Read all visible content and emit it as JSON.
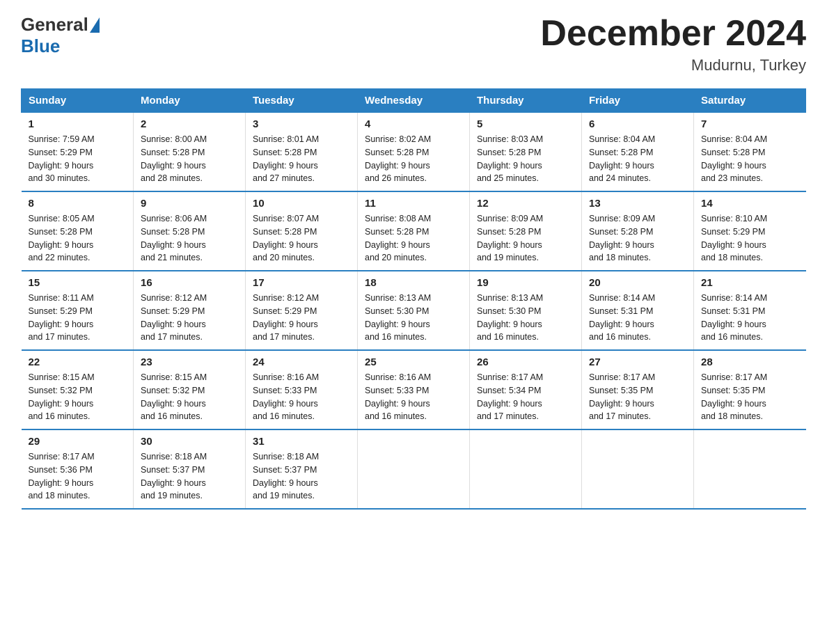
{
  "header": {
    "logo_text_general": "General",
    "logo_text_blue": "Blue",
    "month_title": "December 2024",
    "location": "Mudurnu, Turkey"
  },
  "days_of_week": [
    "Sunday",
    "Monday",
    "Tuesday",
    "Wednesday",
    "Thursday",
    "Friday",
    "Saturday"
  ],
  "weeks": [
    [
      {
        "day": 1,
        "sunrise": "7:59 AM",
        "sunset": "5:29 PM",
        "daylight": "9 hours and 30 minutes."
      },
      {
        "day": 2,
        "sunrise": "8:00 AM",
        "sunset": "5:28 PM",
        "daylight": "9 hours and 28 minutes."
      },
      {
        "day": 3,
        "sunrise": "8:01 AM",
        "sunset": "5:28 PM",
        "daylight": "9 hours and 27 minutes."
      },
      {
        "day": 4,
        "sunrise": "8:02 AM",
        "sunset": "5:28 PM",
        "daylight": "9 hours and 26 minutes."
      },
      {
        "day": 5,
        "sunrise": "8:03 AM",
        "sunset": "5:28 PM",
        "daylight": "9 hours and 25 minutes."
      },
      {
        "day": 6,
        "sunrise": "8:04 AM",
        "sunset": "5:28 PM",
        "daylight": "9 hours and 24 minutes."
      },
      {
        "day": 7,
        "sunrise": "8:04 AM",
        "sunset": "5:28 PM",
        "daylight": "9 hours and 23 minutes."
      }
    ],
    [
      {
        "day": 8,
        "sunrise": "8:05 AM",
        "sunset": "5:28 PM",
        "daylight": "9 hours and 22 minutes."
      },
      {
        "day": 9,
        "sunrise": "8:06 AM",
        "sunset": "5:28 PM",
        "daylight": "9 hours and 21 minutes."
      },
      {
        "day": 10,
        "sunrise": "8:07 AM",
        "sunset": "5:28 PM",
        "daylight": "9 hours and 20 minutes."
      },
      {
        "day": 11,
        "sunrise": "8:08 AM",
        "sunset": "5:28 PM",
        "daylight": "9 hours and 20 minutes."
      },
      {
        "day": 12,
        "sunrise": "8:09 AM",
        "sunset": "5:28 PM",
        "daylight": "9 hours and 19 minutes."
      },
      {
        "day": 13,
        "sunrise": "8:09 AM",
        "sunset": "5:28 PM",
        "daylight": "9 hours and 18 minutes."
      },
      {
        "day": 14,
        "sunrise": "8:10 AM",
        "sunset": "5:29 PM",
        "daylight": "9 hours and 18 minutes."
      }
    ],
    [
      {
        "day": 15,
        "sunrise": "8:11 AM",
        "sunset": "5:29 PM",
        "daylight": "9 hours and 17 minutes."
      },
      {
        "day": 16,
        "sunrise": "8:12 AM",
        "sunset": "5:29 PM",
        "daylight": "9 hours and 17 minutes."
      },
      {
        "day": 17,
        "sunrise": "8:12 AM",
        "sunset": "5:29 PM",
        "daylight": "9 hours and 17 minutes."
      },
      {
        "day": 18,
        "sunrise": "8:13 AM",
        "sunset": "5:30 PM",
        "daylight": "9 hours and 16 minutes."
      },
      {
        "day": 19,
        "sunrise": "8:13 AM",
        "sunset": "5:30 PM",
        "daylight": "9 hours and 16 minutes."
      },
      {
        "day": 20,
        "sunrise": "8:14 AM",
        "sunset": "5:31 PM",
        "daylight": "9 hours and 16 minutes."
      },
      {
        "day": 21,
        "sunrise": "8:14 AM",
        "sunset": "5:31 PM",
        "daylight": "9 hours and 16 minutes."
      }
    ],
    [
      {
        "day": 22,
        "sunrise": "8:15 AM",
        "sunset": "5:32 PM",
        "daylight": "9 hours and 16 minutes."
      },
      {
        "day": 23,
        "sunrise": "8:15 AM",
        "sunset": "5:32 PM",
        "daylight": "9 hours and 16 minutes."
      },
      {
        "day": 24,
        "sunrise": "8:16 AM",
        "sunset": "5:33 PM",
        "daylight": "9 hours and 16 minutes."
      },
      {
        "day": 25,
        "sunrise": "8:16 AM",
        "sunset": "5:33 PM",
        "daylight": "9 hours and 16 minutes."
      },
      {
        "day": 26,
        "sunrise": "8:17 AM",
        "sunset": "5:34 PM",
        "daylight": "9 hours and 17 minutes."
      },
      {
        "day": 27,
        "sunrise": "8:17 AM",
        "sunset": "5:35 PM",
        "daylight": "9 hours and 17 minutes."
      },
      {
        "day": 28,
        "sunrise": "8:17 AM",
        "sunset": "5:35 PM",
        "daylight": "9 hours and 18 minutes."
      }
    ],
    [
      {
        "day": 29,
        "sunrise": "8:17 AM",
        "sunset": "5:36 PM",
        "daylight": "9 hours and 18 minutes."
      },
      {
        "day": 30,
        "sunrise": "8:18 AM",
        "sunset": "5:37 PM",
        "daylight": "9 hours and 19 minutes."
      },
      {
        "day": 31,
        "sunrise": "8:18 AM",
        "sunset": "5:37 PM",
        "daylight": "9 hours and 19 minutes."
      },
      null,
      null,
      null,
      null
    ]
  ],
  "labels": {
    "sunrise": "Sunrise:",
    "sunset": "Sunset:",
    "daylight": "Daylight:"
  }
}
